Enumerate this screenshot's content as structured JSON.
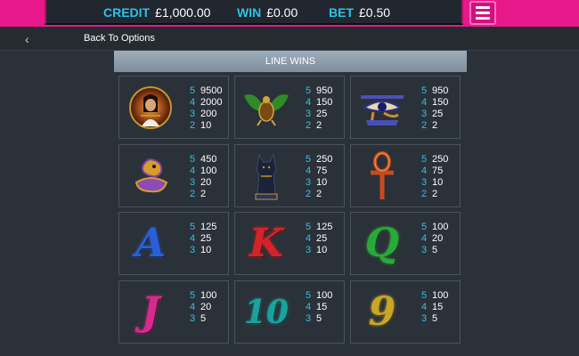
{
  "topbar": {
    "credit_label": "CREDIT",
    "credit_value": "£1,000.00",
    "win_label": "WIN",
    "win_value": "£0.00",
    "bet_label": "BET",
    "bet_value": "£0.50",
    "menu_icon": "hamburger-menu-icon"
  },
  "nav": {
    "back_icon": "chevron-left-icon",
    "back_label": "Back To Options"
  },
  "section": {
    "title": "LINE WINS"
  },
  "symbols": [
    {
      "id": "cleopatra",
      "icon": "cleopatra-symbol-icon",
      "pays": [
        {
          "n": "5",
          "v": "9500"
        },
        {
          "n": "4",
          "v": "2000"
        },
        {
          "n": "3",
          "v": "200"
        },
        {
          "n": "2",
          "v": "10"
        }
      ]
    },
    {
      "id": "scarab",
      "icon": "scarab-symbol-icon",
      "pays": [
        {
          "n": "5",
          "v": "950"
        },
        {
          "n": "4",
          "v": "150"
        },
        {
          "n": "3",
          "v": "25"
        },
        {
          "n": "2",
          "v": "2"
        }
      ]
    },
    {
      "id": "eye-of-horus",
      "icon": "eye-of-horus-symbol-icon",
      "pays": [
        {
          "n": "5",
          "v": "950"
        },
        {
          "n": "4",
          "v": "150"
        },
        {
          "n": "3",
          "v": "25"
        },
        {
          "n": "2",
          "v": "2"
        }
      ]
    },
    {
      "id": "cobra",
      "icon": "cobra-symbol-icon",
      "pays": [
        {
          "n": "5",
          "v": "450"
        },
        {
          "n": "4",
          "v": "100"
        },
        {
          "n": "3",
          "v": "20"
        },
        {
          "n": "2",
          "v": "2"
        }
      ]
    },
    {
      "id": "cat",
      "icon": "cat-statue-symbol-icon",
      "pays": [
        {
          "n": "5",
          "v": "250"
        },
        {
          "n": "4",
          "v": "75"
        },
        {
          "n": "3",
          "v": "10"
        },
        {
          "n": "2",
          "v": "2"
        }
      ]
    },
    {
      "id": "ankh",
      "icon": "ankh-symbol-icon",
      "pays": [
        {
          "n": "5",
          "v": "250"
        },
        {
          "n": "4",
          "v": "75"
        },
        {
          "n": "3",
          "v": "10"
        },
        {
          "n": "2",
          "v": "2"
        }
      ]
    },
    {
      "id": "ace",
      "icon": "letter-a-symbol-icon",
      "letter": "A",
      "color": "#2a5fd6",
      "pays": [
        {
          "n": "5",
          "v": "125"
        },
        {
          "n": "4",
          "v": "25"
        },
        {
          "n": "3",
          "v": "10"
        }
      ]
    },
    {
      "id": "king",
      "icon": "letter-k-symbol-icon",
      "letter": "K",
      "color": "#d4232b",
      "pays": [
        {
          "n": "5",
          "v": "125"
        },
        {
          "n": "4",
          "v": "25"
        },
        {
          "n": "3",
          "v": "10"
        }
      ]
    },
    {
      "id": "queen",
      "icon": "letter-q-symbol-icon",
      "letter": "Q",
      "color": "#2aa83a",
      "pays": [
        {
          "n": "5",
          "v": "100"
        },
        {
          "n": "4",
          "v": "20"
        },
        {
          "n": "3",
          "v": "5"
        }
      ]
    },
    {
      "id": "jack",
      "icon": "letter-j-symbol-icon",
      "letter": "J",
      "color": "#d82a8e",
      "pays": [
        {
          "n": "5",
          "v": "100"
        },
        {
          "n": "4",
          "v": "20"
        },
        {
          "n": "3",
          "v": "5"
        }
      ]
    },
    {
      "id": "ten",
      "icon": "number-10-symbol-icon",
      "letter": "10",
      "color": "#1aa39e",
      "pays": [
        {
          "n": "5",
          "v": "100"
        },
        {
          "n": "4",
          "v": "15"
        },
        {
          "n": "3",
          "v": "5"
        }
      ]
    },
    {
      "id": "nine",
      "icon": "number-9-symbol-icon",
      "letter": "9",
      "color": "#c8a628",
      "pays": [
        {
          "n": "5",
          "v": "100"
        },
        {
          "n": "4",
          "v": "15"
        },
        {
          "n": "3",
          "v": "5"
        }
      ]
    }
  ]
}
